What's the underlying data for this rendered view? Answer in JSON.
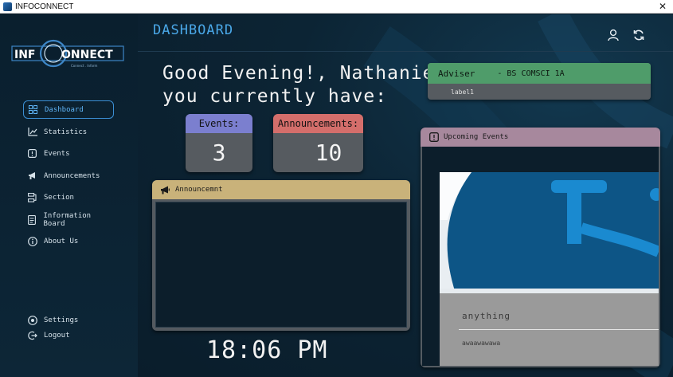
{
  "window": {
    "title": "INFOCONNECT",
    "close_glyph": "✕"
  },
  "logo": {
    "text_left": "INF",
    "text_right": "ONNECT",
    "tagline": "Connect  .  Inform"
  },
  "sidebar": {
    "items": [
      {
        "label": "Dashboard",
        "icon": "dashboard-icon",
        "active": true
      },
      {
        "label": "Statistics",
        "icon": "statistics-icon"
      },
      {
        "label": "Events",
        "icon": "events-icon"
      },
      {
        "label": "Announcements",
        "icon": "megaphone-icon"
      },
      {
        "label": "Section",
        "icon": "section-icon"
      },
      {
        "label": "Information Board",
        "icon": "information-board-icon"
      },
      {
        "label": "About Us",
        "icon": "info-icon"
      }
    ],
    "bottom": [
      {
        "label": "Settings",
        "icon": "settings-icon"
      },
      {
        "label": "Logout",
        "icon": "logout-icon"
      }
    ]
  },
  "header": {
    "title": "DASHBOARD",
    "icons": [
      "user-icon",
      "refresh-icon"
    ]
  },
  "greeting": {
    "line1": "Good Evening!, Nathaniel",
    "line2": "you currently have:"
  },
  "stats": {
    "events": {
      "label": "Events:",
      "value": "3",
      "color": "#7b7fcf"
    },
    "announcements": {
      "label": "Announcements:",
      "value": "10",
      "color": "#d46e6b"
    }
  },
  "adviser": {
    "label": "Adviser",
    "section": "- BS COMSCI 1A",
    "name": "label1",
    "color": "#4f9c6a"
  },
  "announcement_panel": {
    "title": "Announcemnt",
    "color": "#c9b27a"
  },
  "upcoming_events": {
    "title": "Upcoming Events",
    "color": "#a7889d",
    "event_title": "anything",
    "event_desc": "awaawawawa"
  },
  "clock": {
    "time": "18:06 PM"
  },
  "colors": {
    "accent": "#3b8fd4",
    "background": "#0b1d2c"
  }
}
